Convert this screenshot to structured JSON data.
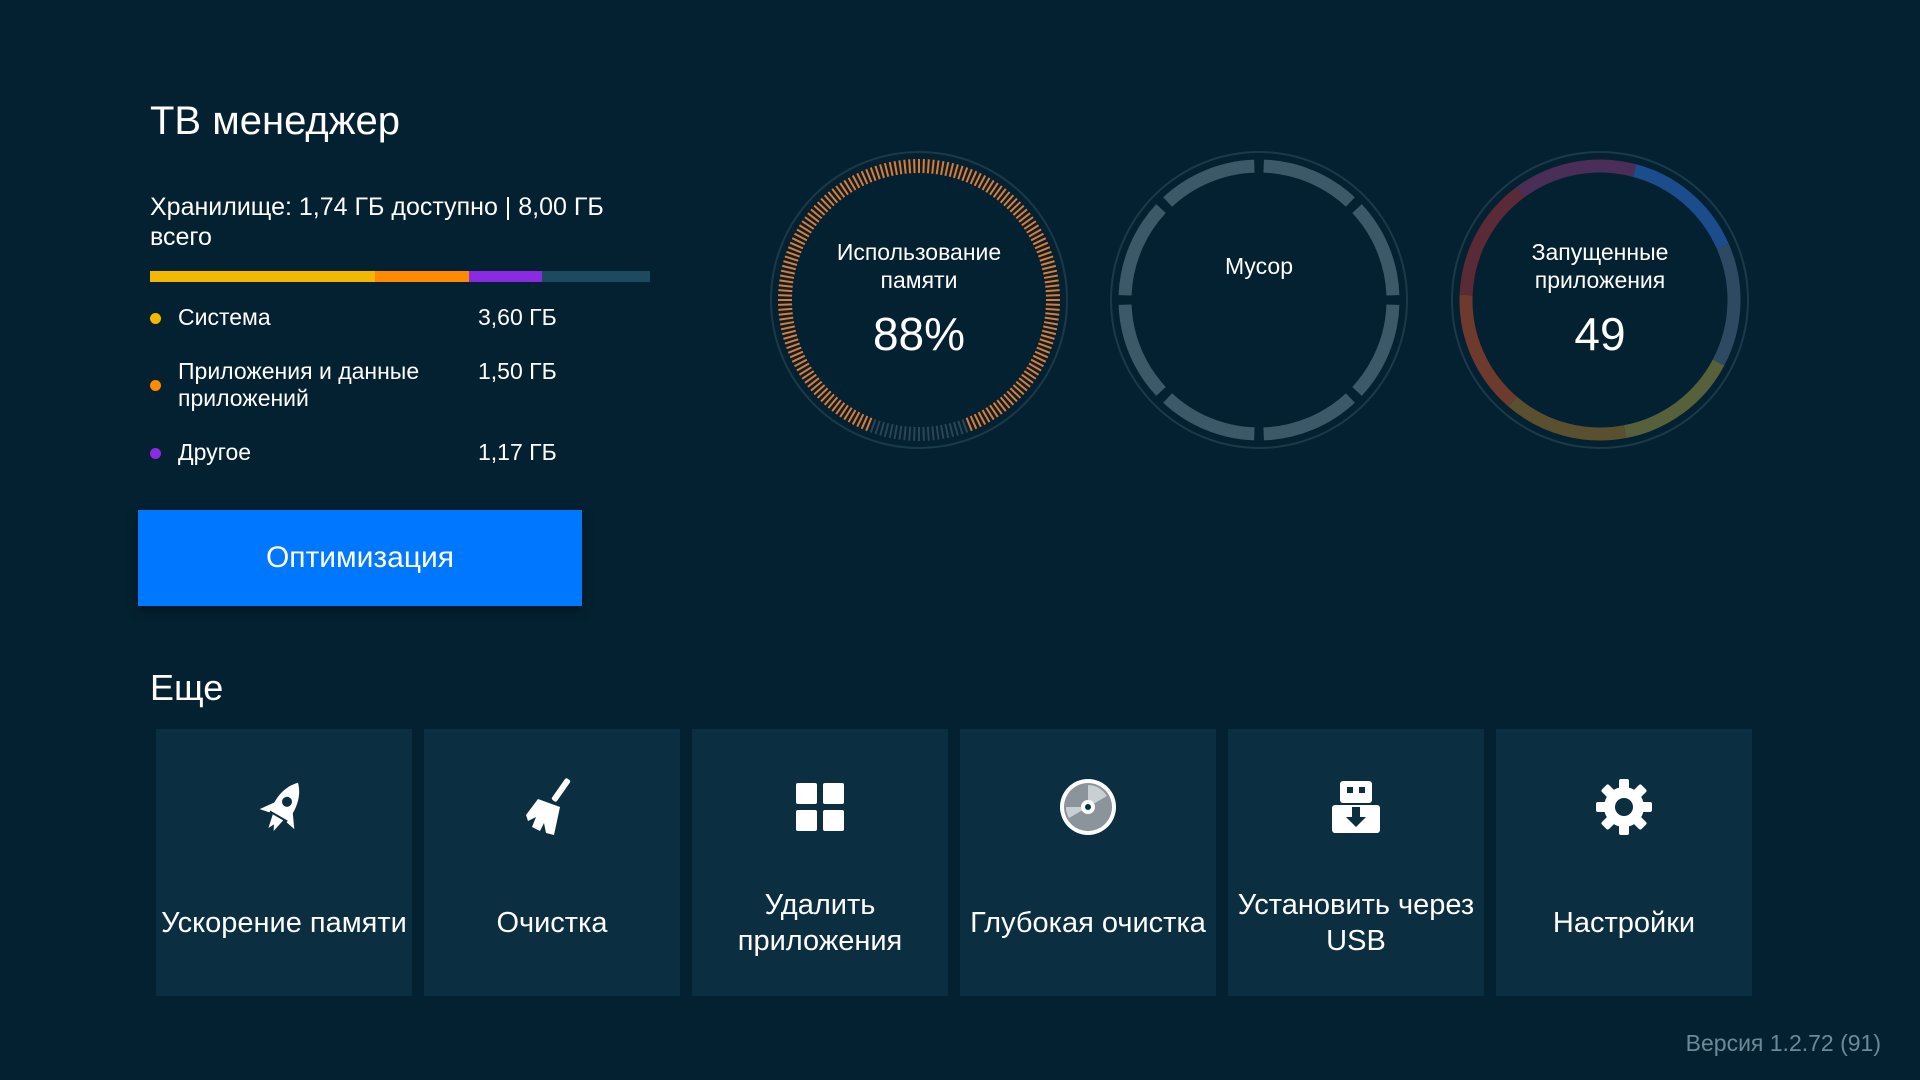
{
  "app": {
    "title": "ТВ менеджер"
  },
  "storage": {
    "summary": "Хранилище: 1,74 ГБ доступно | 8,00 ГБ всего",
    "bar": [
      {
        "key": "system",
        "fraction": 0.45,
        "color": "#f5b800"
      },
      {
        "key": "apps",
        "fraction": 0.1875,
        "color": "#ff8a00"
      },
      {
        "key": "other",
        "fraction": 0.146,
        "color": "#8a2be2"
      },
      {
        "key": "free",
        "fraction": 0.2165,
        "color": "#1d4a5e"
      }
    ],
    "items": [
      {
        "label": "Система",
        "value": "3,60 ГБ",
        "color": "#f5b800"
      },
      {
        "label": "Приложения и данные приложений",
        "value": "1,50 ГБ",
        "color": "#ff8a00"
      },
      {
        "label": "Другое",
        "value": "1,17 ГБ",
        "color": "#8a2be2"
      }
    ]
  },
  "optimize": {
    "label": "Оптимизация"
  },
  "gauges": {
    "memory": {
      "label": "Использование памяти",
      "value": "88%",
      "percent": 88,
      "color": "#e07a30",
      "track": "#2a4656"
    },
    "trash": {
      "label": "Мусор",
      "color": "#3c5968"
    },
    "running": {
      "label": "Запущенные приложения",
      "value": "49",
      "colors": [
        "#1b4c8c",
        "#2e4a62",
        "#56603a",
        "#5a5030",
        "#6e3a2e",
        "#5a2a36",
        "#4a2e58"
      ]
    }
  },
  "more": {
    "title": "Еще",
    "tiles": [
      {
        "name": "memory-boost",
        "icon": "rocket-icon",
        "label": "Ускорение памяти"
      },
      {
        "name": "cleanup",
        "icon": "broom-icon",
        "label": "Очистка"
      },
      {
        "name": "uninstall-apps",
        "icon": "grid-icon",
        "label": "Удалить приложения"
      },
      {
        "name": "deep-clean",
        "icon": "disc-icon",
        "label": "Глубокая очистка"
      },
      {
        "name": "usb-install",
        "icon": "usb-install-icon",
        "label": "Установить через USB"
      },
      {
        "name": "settings",
        "icon": "gear-icon",
        "label": "Настройки"
      }
    ]
  },
  "footer": {
    "version": "Версия 1.2.72 (91)"
  }
}
